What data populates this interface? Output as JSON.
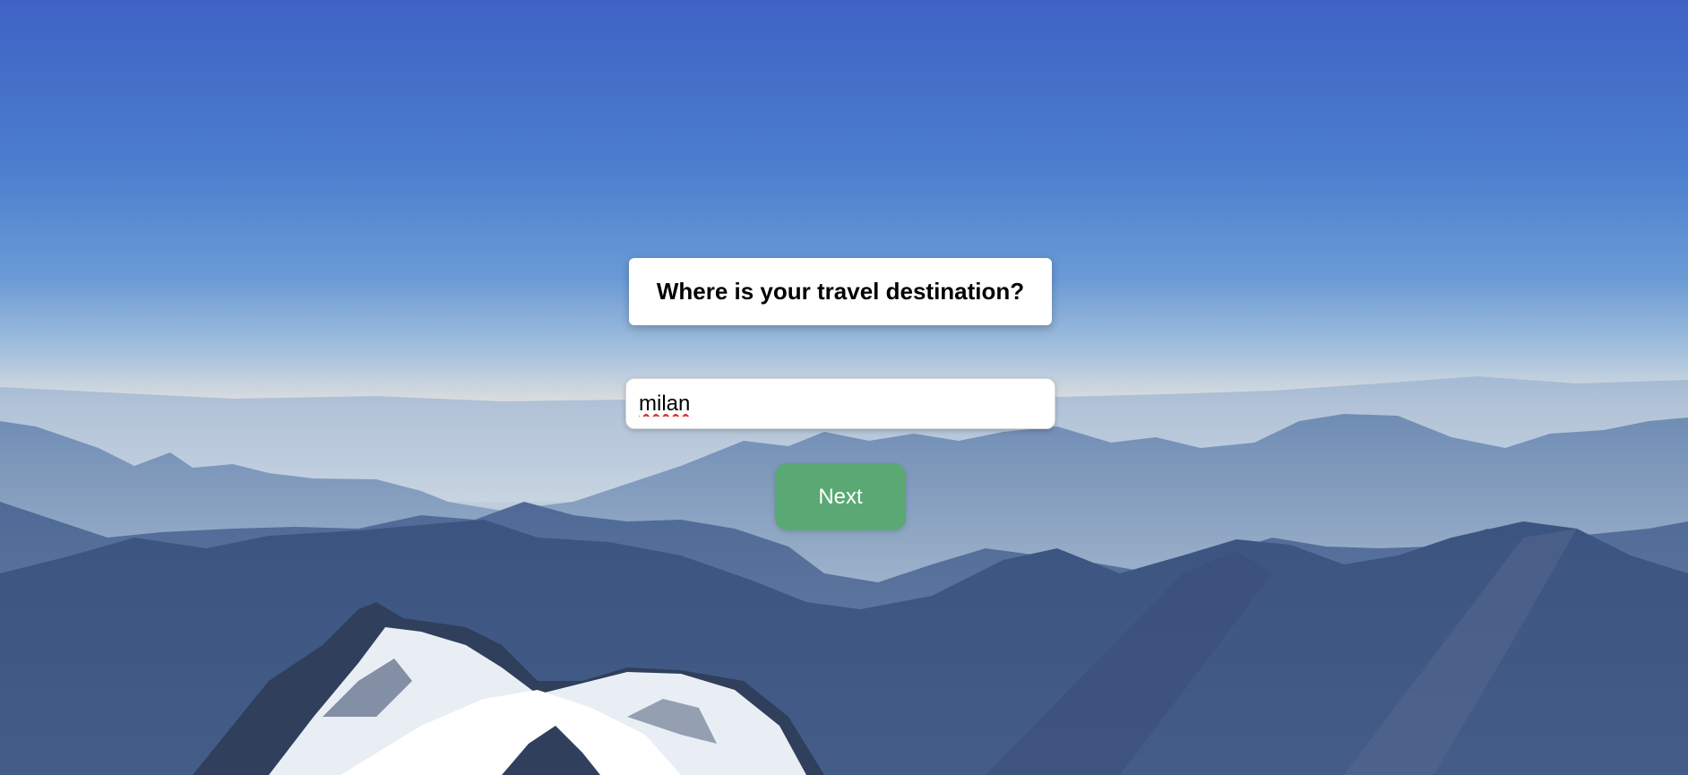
{
  "page": {
    "question": "Where is your travel destination?"
  },
  "destination_input": {
    "value": "milan"
  },
  "next_button": {
    "label": "Next"
  },
  "colors": {
    "sky_top": "#3e62c4",
    "sky_mid": "#6a9bd6",
    "horizon_haze": "#e4e2df",
    "button": "#5aa873",
    "card": "#ffffff"
  },
  "background": {
    "subject": "mountain-landscape"
  }
}
